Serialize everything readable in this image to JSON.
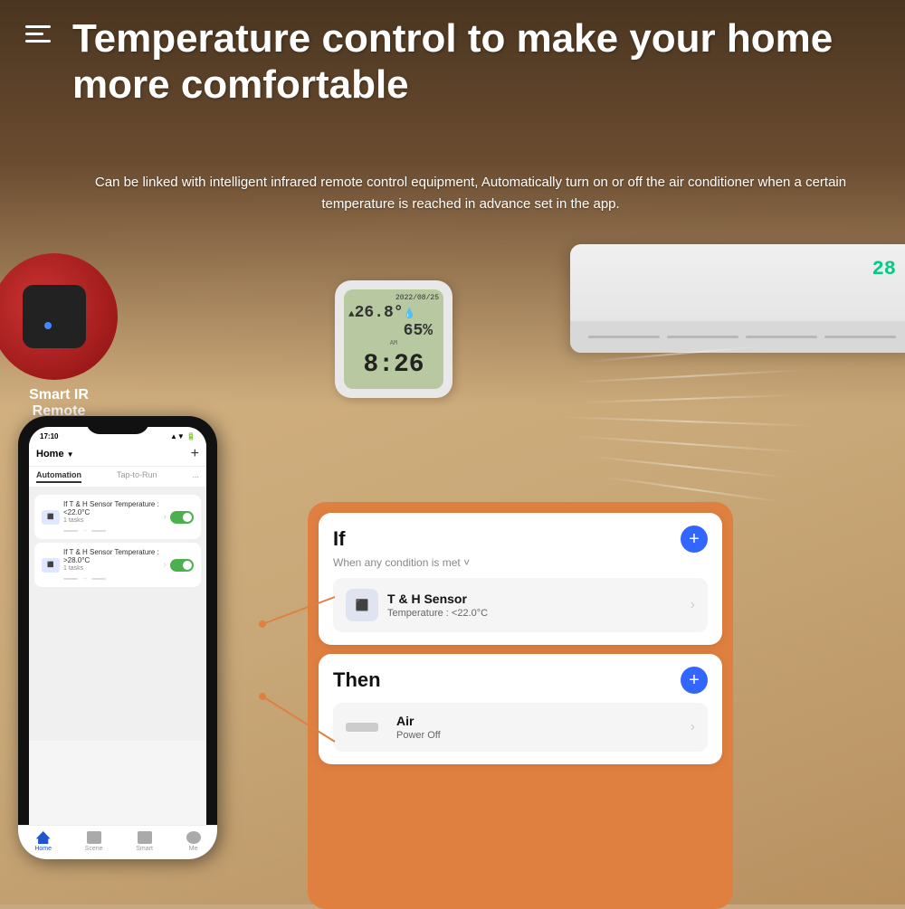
{
  "hero": {
    "title": "Temperature control to make your home more comfortable",
    "subtitle": "Can be linked with intelligent infrared remote control equipment, Automatically turn on or off the air conditioner when a certain temperature is reached in advance set in the app."
  },
  "devices": {
    "smart_ir_label": "Smart IR\nRemote",
    "sensor_date": "2022/08/25",
    "sensor_temp": "26.8",
    "sensor_humidity": "65%",
    "sensor_time": "8:26",
    "ac_display": "28"
  },
  "phone": {
    "status_time": "17:10",
    "nav_title": "Home",
    "plus_label": "+",
    "tabs": {
      "automation": "Automation",
      "tap_to_run": "Tap-to-Run",
      "dots": "..."
    },
    "automations": [
      {
        "text": "If T & H Sensor Temperature : <22.0°C",
        "sub": "1 tasks",
        "enabled": true
      },
      {
        "text": "If T & H Sensor Temperature : >28.0°C",
        "sub": "1 tasks",
        "enabled": true
      }
    ],
    "bottom_nav": [
      "Home",
      "Scene",
      "Smart",
      "Me"
    ]
  },
  "if_card": {
    "label": "If",
    "subtitle": "When any condition is met ˅",
    "plus": "+",
    "sensor_name": "T & H Sensor",
    "sensor_value": "Temperature : <22.0°C"
  },
  "then_card": {
    "label": "Then",
    "plus": "+",
    "air_name": "Air",
    "air_value": "Power Off"
  }
}
